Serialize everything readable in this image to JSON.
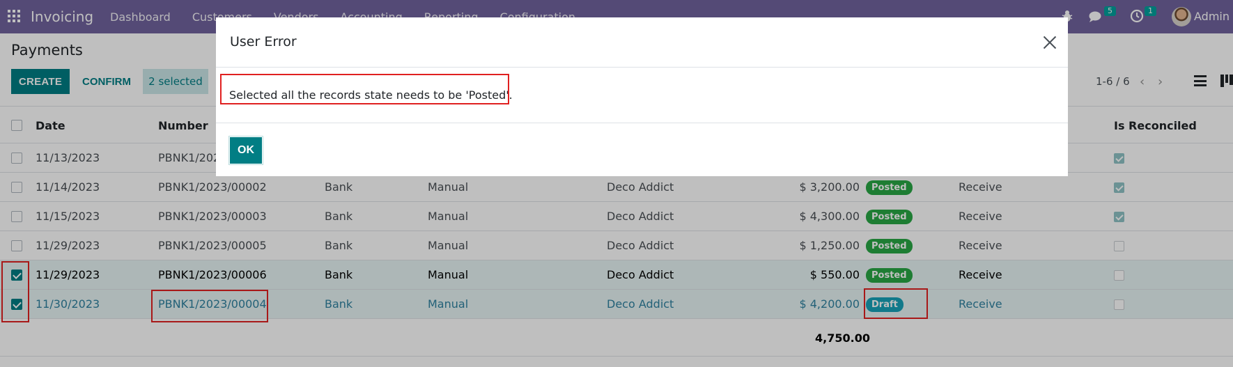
{
  "topnav": {
    "app_name": "Invoicing",
    "menu": [
      "Dashboard",
      "Customers",
      "Vendors",
      "Accounting",
      "Reporting",
      "Configuration"
    ],
    "messages_count": "5",
    "activities_count": "1",
    "user": "Admin ("
  },
  "control": {
    "title": "Payments",
    "create_label": "CREATE",
    "confirm_label": "CONFIRM",
    "selected_label": "2 selected",
    "pager": "1-6 / 6"
  },
  "table": {
    "headers": {
      "date": "Date",
      "number": "Number",
      "is_reconciled": "Is Reconciled"
    },
    "rows": [
      {
        "date": "11/13/2023",
        "number": "PBNK1/202",
        "journal": "",
        "method": "",
        "partner": "",
        "amount": "",
        "status": "",
        "type": "",
        "reconciled": true,
        "selected": false
      },
      {
        "date": "11/14/2023",
        "number": "PBNK1/2023/00002",
        "journal": "Bank",
        "method": "Manual",
        "partner": "Deco Addict",
        "amount": "$ 3,200.00",
        "status": "Posted",
        "type": "Receive",
        "reconciled": true,
        "selected": false
      },
      {
        "date": "11/15/2023",
        "number": "PBNK1/2023/00003",
        "journal": "Bank",
        "method": "Manual",
        "partner": "Deco Addict",
        "amount": "$ 4,300.00",
        "status": "Posted",
        "type": "Receive",
        "reconciled": true,
        "selected": false
      },
      {
        "date": "11/29/2023",
        "number": "PBNK1/2023/00005",
        "journal": "Bank",
        "method": "Manual",
        "partner": "Deco Addict",
        "amount": "$ 1,250.00",
        "status": "Posted",
        "type": "Receive",
        "reconciled": false,
        "selected": false
      },
      {
        "date": "11/29/2023",
        "number": "PBNK1/2023/00006",
        "journal": "Bank",
        "method": "Manual",
        "partner": "Deco Addict",
        "amount": "$ 550.00",
        "status": "Posted",
        "type": "Receive",
        "reconciled": false,
        "selected": true
      },
      {
        "date": "11/30/2023",
        "number": "PBNK1/2023/00004",
        "journal": "Bank",
        "method": "Manual",
        "partner": "Deco Addict",
        "amount": "$ 4,200.00",
        "status": "Draft",
        "type": "Receive",
        "reconciled": false,
        "selected": true
      }
    ],
    "total": "4,750.00"
  },
  "dialog": {
    "title": "User Error",
    "message": "Selected all the records state needs to be 'Posted'.",
    "ok_label": "OK"
  },
  "colors": {
    "primary": "#017e84",
    "navbar": "#71639e",
    "posted": "#28a745",
    "draft": "#17a2b8",
    "annotation": "#e02020"
  }
}
